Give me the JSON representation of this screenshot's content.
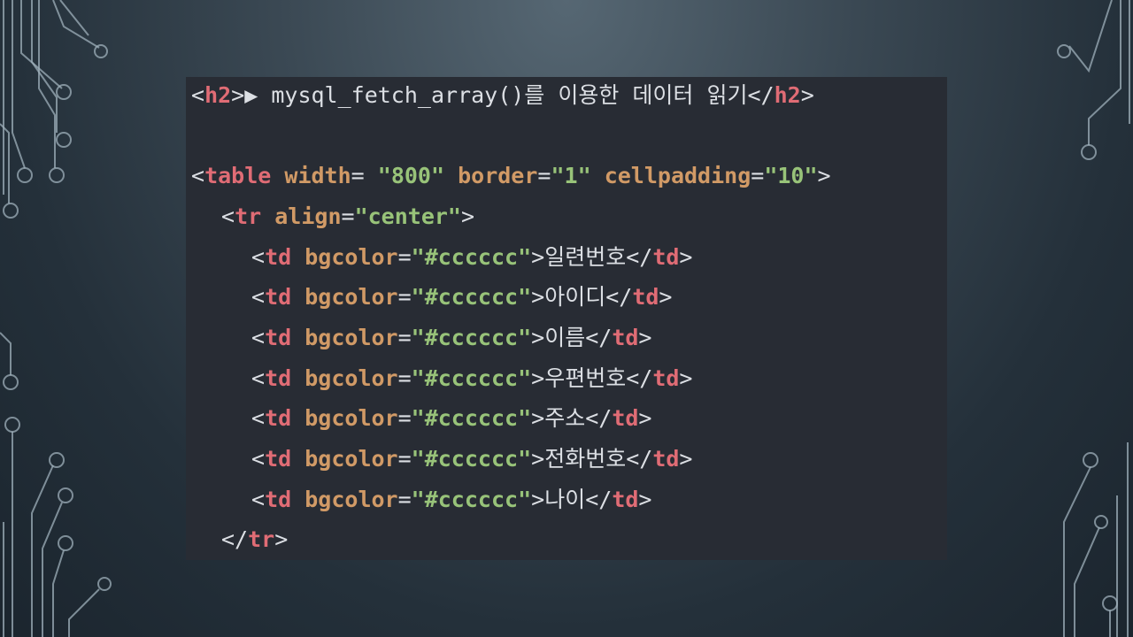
{
  "code": {
    "line1": {
      "open_lt": "<",
      "open_tag": "h2",
      "open_gt": ">",
      "text": "▶ mysql_fetch_array()를 이용한 데이터 읽기",
      "close_lt": "</",
      "close_tag": "h2",
      "close_gt": ">"
    },
    "line2": {
      "lt": "<",
      "tag": "table",
      "a1_name": "width",
      "a1_eq": "= ",
      "a1_val": "\"800\"",
      "a2_name": "border",
      "a2_eq": "=",
      "a2_val": "\"1\"",
      "a3_name": "cellpadding",
      "a3_eq": "=",
      "a3_val": "\"10\"",
      "gt": ">"
    },
    "line3": {
      "lt": "<",
      "tag": "tr",
      "a_name": "align",
      "a_eq": "=",
      "a_val": "\"center\"",
      "gt": ">"
    },
    "td_attr_name": "bgcolor",
    "td_attr_eq": "=",
    "td_attr_val": "\"#cccccc\"",
    "td_tag": "td",
    "cells": [
      {
        "text": "일련번호"
      },
      {
        "text": "아이디"
      },
      {
        "text": "이름"
      },
      {
        "text": "우편번호"
      },
      {
        "text": "주소"
      },
      {
        "text": "전화번호"
      },
      {
        "text": "나이"
      }
    ],
    "line_end": {
      "lt": "</",
      "tag": "tr",
      "gt": ">"
    }
  }
}
